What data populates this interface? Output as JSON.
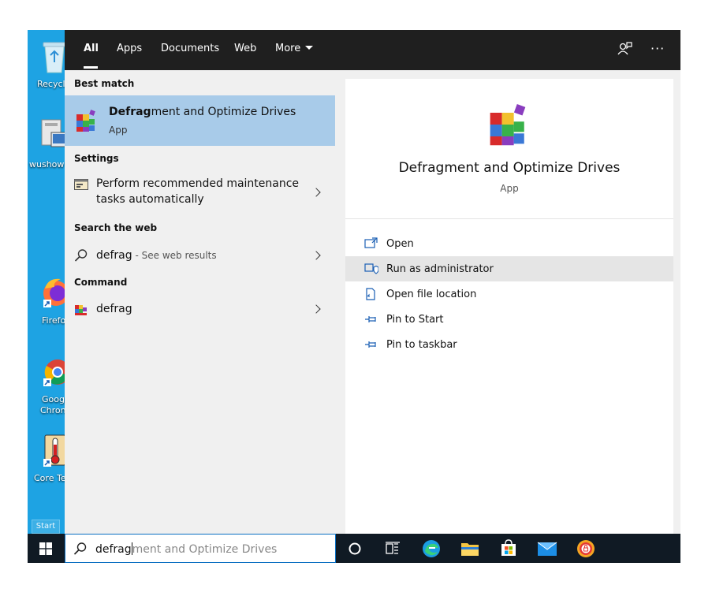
{
  "desktop": {
    "icons": [
      {
        "label": "Recycle"
      },
      {
        "label": "wushow"
      },
      {
        "label": "Firefo"
      },
      {
        "label": "Goog"
      },
      {
        "label": "Chron"
      },
      {
        "label": "Core Te"
      }
    ],
    "start_tooltip": "Start"
  },
  "tabs": [
    {
      "label": "All"
    },
    {
      "label": "Apps"
    },
    {
      "label": "Documents"
    },
    {
      "label": "Web"
    },
    {
      "label": "More"
    }
  ],
  "results": {
    "best_match_header": "Best match",
    "best_match": {
      "title_bold": "Defrag",
      "title_rest": "ment and Optimize Drives",
      "type": "App"
    },
    "settings_header": "Settings",
    "settings_item": {
      "line1": "Perform recommended maintenance",
      "line2": "tasks automatically"
    },
    "web_header": "Search the web",
    "web_item": {
      "query": "defrag",
      "suffix": " - See web results"
    },
    "command_header": "Command",
    "command_item": {
      "label": "defrag"
    }
  },
  "detail": {
    "app_name": "Defragment and Optimize Drives",
    "app_type": "App",
    "actions": [
      {
        "label": "Open"
      },
      {
        "label": "Run as administrator"
      },
      {
        "label": "Open file location"
      },
      {
        "label": "Pin to Start"
      },
      {
        "label": "Pin to taskbar"
      }
    ]
  },
  "search": {
    "typed": "defrag",
    "suggestion": "ment and Optimize Drives"
  },
  "colors": {
    "desktop": "#1ea3e3",
    "selected": "#a8cbe9",
    "topbar": "#1f1f1f",
    "taskbar": "#101a24"
  }
}
